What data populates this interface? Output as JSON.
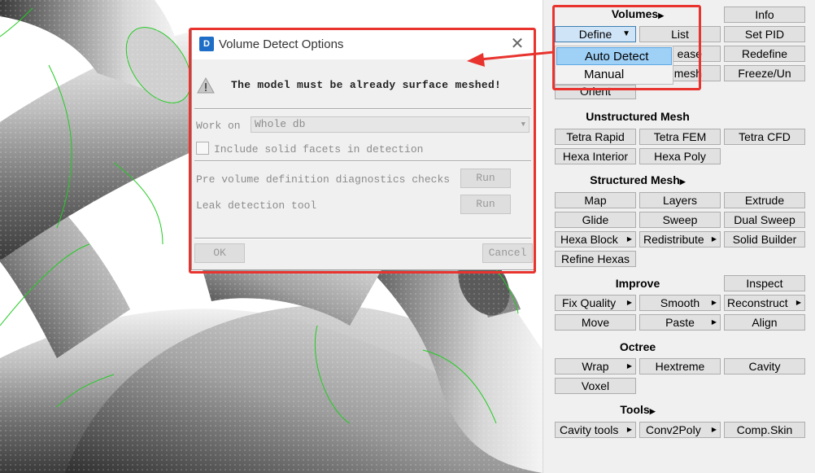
{
  "dialog": {
    "title": "Volume Detect Options",
    "logo": "D",
    "close_glyph": "✕",
    "warning_icon": "warning-triangle-icon",
    "warning_text": "The model must be already surface meshed!",
    "work_on_label": "Work on",
    "work_on_value": "Whole db",
    "include_facets_label": "Include solid facets in detection",
    "pre_volume_label": "Pre volume definition diagnostics checks",
    "pre_volume_button": "Run",
    "leak_label": "Leak detection tool",
    "leak_button": "Run",
    "ok_button": "OK",
    "cancel_button": "Cancel"
  },
  "panel": {
    "volumes": {
      "header": "Volumes",
      "define": "Define",
      "list": "List",
      "release_partial": "ease",
      "remesh_partial": "mesh",
      "orient": "Orient",
      "info": "Info",
      "set_pid": "Set PID",
      "redefine": "Redefine",
      "freeze": "Freeze/Un"
    },
    "define_menu": {
      "auto_detect": "Auto Detect",
      "manual": "Manual"
    },
    "unstructured": {
      "header": "Unstructured Mesh",
      "tetra_rapid": "Tetra Rapid",
      "tetra_fem": "Tetra FEM",
      "tetra_cfd": "Tetra CFD",
      "hexa_interior": "Hexa Interior",
      "hexa_poly": "Hexa Poly"
    },
    "structured": {
      "header": "Structured Mesh",
      "map": "Map",
      "layers": "Layers",
      "extrude": "Extrude",
      "glide": "Glide",
      "sweep": "Sweep",
      "dual_sweep": "Dual Sweep",
      "hexa_block": "Hexa Block",
      "redistribute": "Redistribute",
      "solid_builder": "Solid Builder",
      "refine_hexas": "Refine Hexas"
    },
    "improve": {
      "header": "Improve",
      "inspect": "Inspect",
      "fix_quality": "Fix Quality",
      "smooth": "Smooth",
      "reconstruct": "Reconstruct",
      "move": "Move",
      "paste": "Paste",
      "align": "Align"
    },
    "octree": {
      "header": "Octree",
      "wrap": "Wrap",
      "hextreme": "Hextreme",
      "cavity": "Cavity",
      "voxel": "Voxel"
    },
    "tools": {
      "header": "Tools",
      "cavity_tools": "Cavity tools",
      "conv2poly": "Conv2Poly",
      "comp_skin": "Comp.Skin"
    }
  },
  "icons": {
    "submenu": "submenu-triangle-icon",
    "dropdown": "dropdown-arrow-icon"
  },
  "colors": {
    "annotation_red": "#e8332e",
    "menu_highlight": "#9fd0f6",
    "mesh_edge": "#22cc22"
  }
}
